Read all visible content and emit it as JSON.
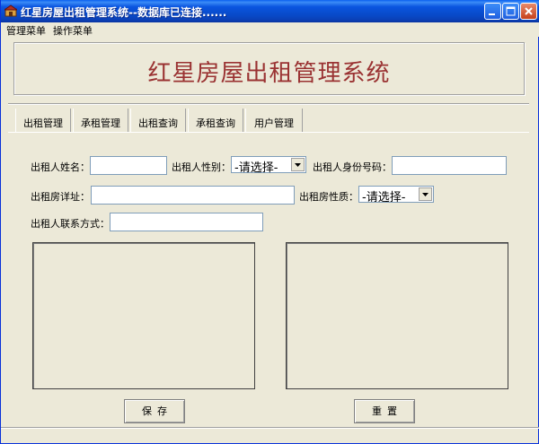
{
  "window": {
    "title": "红星房屋出租管理系统--数据库已连接......",
    "icon": "app-icon"
  },
  "menubar": {
    "items": [
      {
        "label": "管理菜单"
      },
      {
        "label": "操作菜单"
      }
    ]
  },
  "banner": {
    "title": "红星房屋出租管理系统"
  },
  "tabs": [
    {
      "label": "出租管理"
    },
    {
      "label": "承租管理"
    },
    {
      "label": "出租查询"
    },
    {
      "label": "承租查询"
    },
    {
      "label": "用户管理"
    }
  ],
  "form": {
    "name_label": "出租人姓名：",
    "name_value": "",
    "gender_label": "出租人性别：",
    "gender_selected": "-请选择-",
    "id_label": "出租人身份号码：",
    "id_value": "",
    "address_label": "出租房详址：",
    "address_value": "",
    "property_label": "出租房性质：",
    "property_selected": "-请选择-",
    "contact_label": "出租人联系方式：",
    "contact_value": ""
  },
  "buttons": {
    "save_label": "保存",
    "reset_label": "重置"
  },
  "colors": {
    "titlebar": "#0a55e0",
    "banner_title": "#9a3232",
    "background": "#ece9d8"
  }
}
